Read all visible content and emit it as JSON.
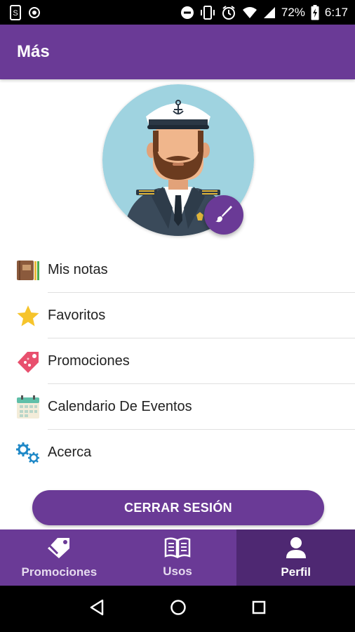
{
  "status_bar": {
    "battery_percent": "72%",
    "time": "6:17"
  },
  "app_bar": {
    "title": "Más"
  },
  "profile": {
    "avatar_icon": "captain-avatar-icon",
    "edit_icon": "brush-icon"
  },
  "menu": {
    "items": [
      {
        "label": "Mis notas",
        "icon": "notebook-icon"
      },
      {
        "label": "Favoritos",
        "icon": "star-icon"
      },
      {
        "label": "Promociones",
        "icon": "tag-icon"
      },
      {
        "label": "Calendario De Eventos",
        "icon": "calendar-icon"
      },
      {
        "label": "Acerca",
        "icon": "gears-icon"
      }
    ]
  },
  "logout": {
    "label": "CERRAR SESIÓN"
  },
  "bottom_nav": {
    "tabs": [
      {
        "label": "Promociones",
        "icon": "tag-icon",
        "active": false
      },
      {
        "label": "Usos",
        "icon": "book-icon",
        "active": false
      },
      {
        "label": "Perfil",
        "icon": "user-icon",
        "active": true
      }
    ]
  },
  "colors": {
    "primary": "#6a3a96",
    "primary_dark": "#4e2872",
    "divider": "#e0e0e0"
  }
}
